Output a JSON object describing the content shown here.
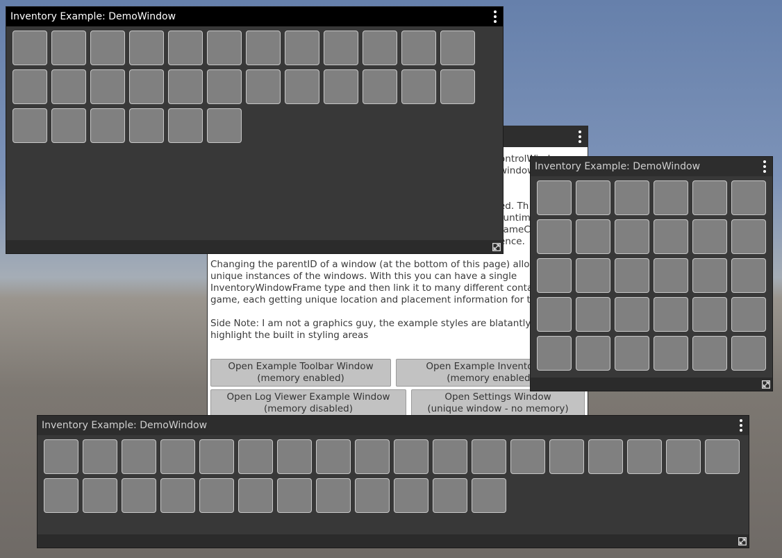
{
  "background_colors": {
    "sky": "#6680ab",
    "ground": "#6f6a66"
  },
  "window_color": "#383838",
  "slot_color": "#808080",
  "docwindow": {
    "text_partial_right": [
      "ontrolWindo",
      "window",
      "ed. Th",
      "runtim",
      "rameC",
      "ence."
    ],
    "paragraph1": [
      "Changing the parentID of a window (at the bottom of this page) allows",
      "unique instances of the windows. With this you can have a single",
      "InventoryWindowFrame type and then link it to many different contain",
      "game, each getting unique location and placement information for the"
    ],
    "paragraph2": [
      "Side Note: I am not a graphics guy, the example styles are blatantly ug",
      "highlight the built in styling areas"
    ],
    "buttons": [
      {
        "line1": "Open Example Toolbar Window",
        "line2": "(memory enabled)"
      },
      {
        "line1": "Open Example Inventory W",
        "line2": "(memory enabled)"
      },
      {
        "line1": "Open Log Viewer Example Window",
        "line2": "(memory disabled)"
      },
      {
        "line1": "Open Settings Window",
        "line2": "(unique window - no memory)"
      }
    ]
  },
  "windows": [
    {
      "title": "Inventory Example: DemoWindow",
      "slot_count": 30
    },
    {
      "title": "Inventory Example: DemoWindow",
      "slot_count": 30
    },
    {
      "title": "Inventory Example: DemoWindow",
      "slot_count": 30
    }
  ],
  "icons": {
    "menu": "kebab-menu-icon",
    "resize": "resize-expand-icon"
  }
}
